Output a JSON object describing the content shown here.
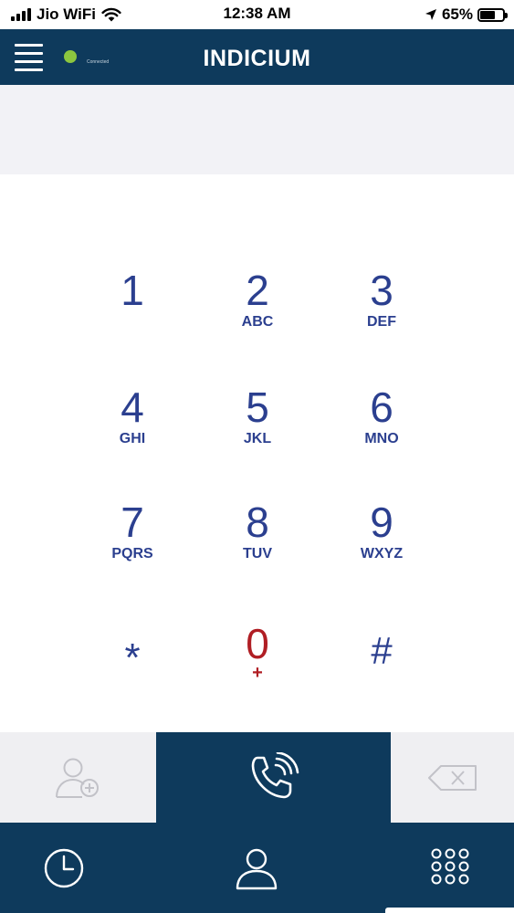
{
  "status_bar": {
    "carrier": "Jio WiFi",
    "time": "12:38 AM",
    "battery": "65%",
    "battery_level": 0.65
  },
  "header": {
    "title": "INDICIUM",
    "status_text": "Connected",
    "status_color": "#8cc63f"
  },
  "dialer": {
    "number": ""
  },
  "keypad": {
    "keys": [
      {
        "digit": "1",
        "letters": ""
      },
      {
        "digit": "2",
        "letters": "ABC"
      },
      {
        "digit": "3",
        "letters": "DEF"
      },
      {
        "digit": "4",
        "letters": "GHI"
      },
      {
        "digit": "5",
        "letters": "JKL"
      },
      {
        "digit": "6",
        "letters": "MNO"
      },
      {
        "digit": "7",
        "letters": "PQRS"
      },
      {
        "digit": "8",
        "letters": "TUV"
      },
      {
        "digit": "9",
        "letters": "WXYZ"
      },
      {
        "digit": "*",
        "letters": ""
      },
      {
        "digit": "0",
        "letters": "+"
      },
      {
        "digit": "#",
        "letters": ""
      }
    ]
  },
  "colors": {
    "primary": "#0e3a5c",
    "key_text": "#2b3f8f",
    "zero_key": "#b01e24",
    "panel_bg": "#efeff2"
  },
  "icons": {
    "menu": "hamburger-menu-icon",
    "add_contact": "add-contact-icon",
    "call": "phone-call-icon",
    "backspace": "backspace-icon",
    "history": "clock-icon",
    "contacts": "person-icon",
    "dialpad": "dialpad-icon"
  }
}
